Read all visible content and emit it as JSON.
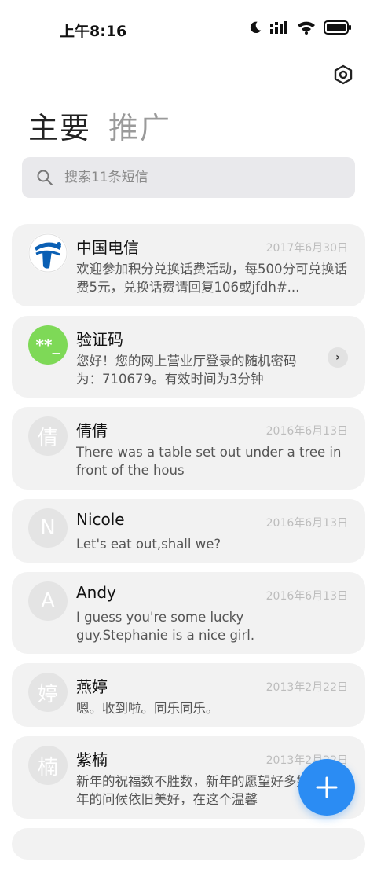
{
  "status_bar": {
    "time": "上午8:16",
    "icons": [
      "moon-icon",
      "signal-icon",
      "wifi-icon",
      "battery-icon"
    ]
  },
  "header": {
    "settings_icon": "settings-hexagon-icon"
  },
  "tabs": [
    {
      "label": "主要",
      "active": true
    },
    {
      "label": "推广",
      "active": false
    }
  ],
  "search": {
    "placeholder": "搜索11条短信"
  },
  "messages": [
    {
      "avatar": "",
      "name": "中国电信",
      "date": "2017年6月30日",
      "preview": "欢迎参加积分兑换话费活动，每500分可兑换话费5元，兑换话费请回复106或jfdh#..."
    },
    {
      "avatar": "**_",
      "name": "验证码",
      "date": "",
      "preview": "您好！您的网上营业厅登录的随机密码为：710679。有效时间为3分钟"
    },
    {
      "avatar": "倩",
      "name": "倩倩",
      "date": "2016年6月13日",
      "preview": "There was a table set out under a tree in front of the hous"
    },
    {
      "avatar": "N",
      "name": "Nicole",
      "date": "2016年6月13日",
      "preview": "Let's eat out,shall we?"
    },
    {
      "avatar": "A",
      "name": "Andy",
      "date": "2016年6月13日",
      "preview": "I guess you're some lucky guy.Stephanie is a nice girl."
    },
    {
      "avatar": "婷",
      "name": "燕婷",
      "date": "2013年2月22日",
      "preview": "嗯。收到啦。同乐同乐。"
    },
    {
      "avatar": "楠",
      "name": "紫楠",
      "date": "2013年2月22日",
      "preview": "新年的祝福数不胜数，新年的愿望好多好多，新年的问候依旧美好，在这个温馨"
    }
  ],
  "fab": {
    "icon": "plus-icon"
  },
  "colors": {
    "accent": "#2b8cf3",
    "card": "#f2f2f2",
    "verify_green": "#7ed957",
    "telecom_blue": "#0a5fb4"
  }
}
